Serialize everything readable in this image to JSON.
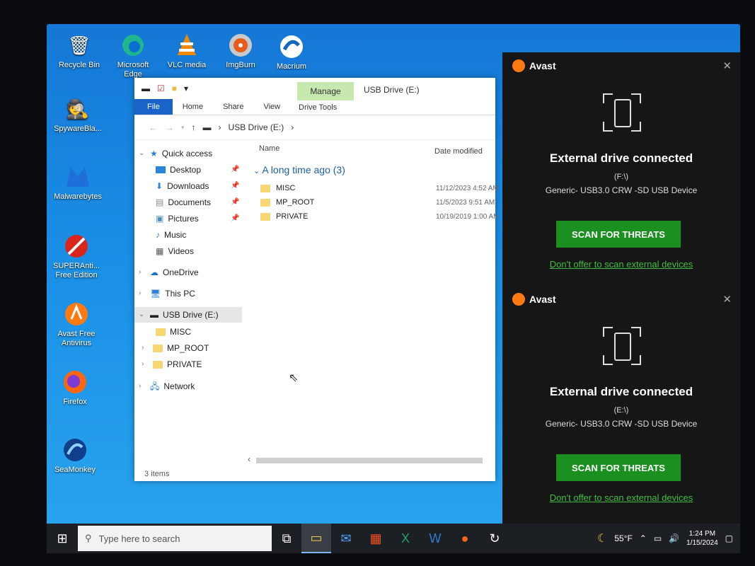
{
  "desktop": {
    "icons": [
      {
        "label": "Recycle Bin",
        "icon": "recycle-bin-icon"
      },
      {
        "label": "Microsoft Edge",
        "icon": "edge-icon"
      },
      {
        "label": "VLC media",
        "icon": "vlc-icon"
      },
      {
        "label": "ImgBurn",
        "icon": "imgburn-icon"
      },
      {
        "label": "Macrium",
        "icon": "macrium-icon"
      },
      {
        "label": "SpywareBla...",
        "icon": "spywareblaster-icon"
      },
      {
        "label": "Malwarebytes",
        "icon": "malwarebytes-icon"
      },
      {
        "label": "SUPERAnti... Free Edition",
        "icon": "superantispyware-icon"
      },
      {
        "label": "Avast Free Antivirus",
        "icon": "avast-icon"
      },
      {
        "label": "Firefox",
        "icon": "firefox-icon"
      },
      {
        "label": "SeaMonkey",
        "icon": "seamonkey-icon"
      }
    ]
  },
  "explorer": {
    "title": "USB Drive (E:)",
    "manage_tab": "Manage",
    "drive_tools": "Drive Tools",
    "ribbon": {
      "file": "File",
      "home": "Home",
      "share": "Share",
      "view": "View"
    },
    "address": "USB Drive (E:)",
    "columns": {
      "name": "Name",
      "date": "Date modified"
    },
    "group_label": "A long time ago (3)",
    "files": [
      {
        "name": "MISC",
        "date": "11/12/2023 4:52 AM"
      },
      {
        "name": "MP_ROOT",
        "date": "11/5/2023 9:51 AM"
      },
      {
        "name": "PRIVATE",
        "date": "10/19/2019 1:00 AM"
      }
    ],
    "nav": {
      "quick_access": "Quick access",
      "desktop": "Desktop",
      "downloads": "Downloads",
      "documents": "Documents",
      "pictures": "Pictures",
      "music": "Music",
      "videos": "Videos",
      "onedrive": "OneDrive",
      "this_pc": "This PC",
      "usb_drive": "USB Drive (E:)",
      "misc": "MISC",
      "mp_root": "MP_ROOT",
      "private": "PRIVATE",
      "network": "Network"
    },
    "status": "3 items"
  },
  "avast": {
    "cards": [
      {
        "brand": "Avast",
        "heading": "External drive connected",
        "drive": "(F:\\)",
        "device": "Generic- USB3.0 CRW -SD USB Device",
        "scan_label": "SCAN FOR THREATS",
        "link": "Don't offer to scan external devices"
      },
      {
        "brand": "Avast",
        "heading": "External drive connected",
        "drive": "(E:\\)",
        "device": "Generic- USB3.0 CRW -SD USB Device",
        "scan_label": "SCAN FOR THREATS",
        "link": "Don't offer to scan external devices"
      }
    ],
    "accent": "#1b8f1f"
  },
  "taskbar": {
    "search_placeholder": "Type here to search",
    "weather": "55°F",
    "time": "1:24 PM",
    "date": "1/15/2024"
  }
}
